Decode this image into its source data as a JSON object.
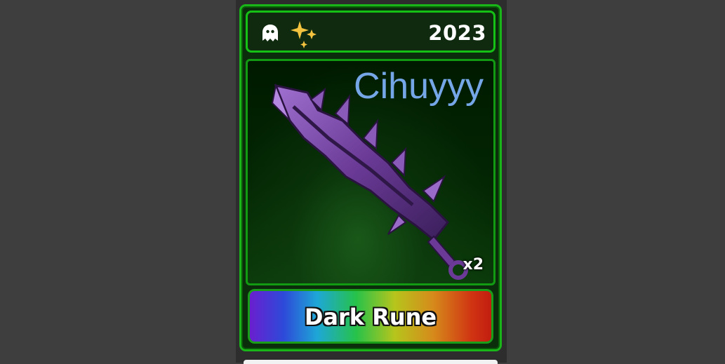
{
  "card": {
    "year": "2023",
    "owner_name": "Cihuyyy",
    "item_name": "Dark Rune",
    "quantity": "x2",
    "header_icons": [
      "ghost-icon",
      "sparkles-icon"
    ],
    "item_image": "dark-rune-sword",
    "colors": {
      "border": "#19b519",
      "owner_text": "#75a7e8",
      "sword": "#7b4aa8",
      "sparkle": "#f3c340"
    }
  }
}
